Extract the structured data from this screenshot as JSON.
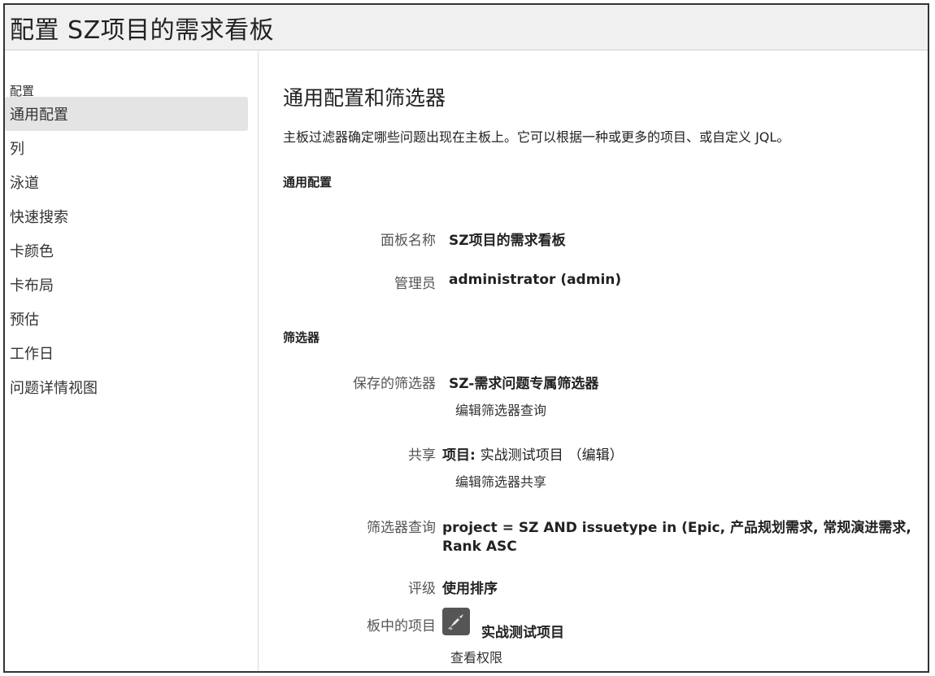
{
  "header": {
    "title": "配置 SZ项目的需求看板"
  },
  "sidebar": {
    "heading": "配置",
    "items": [
      {
        "label": "通用配置",
        "active": true
      },
      {
        "label": "列"
      },
      {
        "label": "泳道"
      },
      {
        "label": "快速搜索"
      },
      {
        "label": "卡颜色"
      },
      {
        "label": "卡布局"
      },
      {
        "label": "预估"
      },
      {
        "label": "工作日"
      },
      {
        "label": "问题详情视图"
      }
    ]
  },
  "main": {
    "title": "通用配置和筛选器",
    "description": "主板过滤器确定哪些问题出现在主板上。它可以根据一种或更多的项目、或自定义 JQL。",
    "general": {
      "heading": "通用配置",
      "board_name_label": "面板名称",
      "board_name_value": "SZ项目的需求看板",
      "admin_label": "管理员",
      "admin_value": "administrator (admin)"
    },
    "filter": {
      "heading": "筛选器",
      "saved_label": "保存的筛选器",
      "saved_value": "SZ-需求问题专属筛选器",
      "edit_query_link": "编辑筛选器查询",
      "share_label": "共享",
      "share_prefix": "项目:",
      "share_project": "实战测试项目",
      "share_edit": "（编辑）",
      "edit_share_link": "编辑筛选器共享",
      "query_label": "筛选器查询",
      "query_line1": "project = SZ AND issuetype in (Epic, 产品规划需求, 常规演进需求,",
      "query_line2": "Rank ASC",
      "rank_label": "评级",
      "rank_value": "使用排序",
      "projects_label": "板中的项目",
      "project_name": "实战测试项目",
      "project_icon": "rocket-icon",
      "view_permissions_link": "查看权限"
    }
  }
}
